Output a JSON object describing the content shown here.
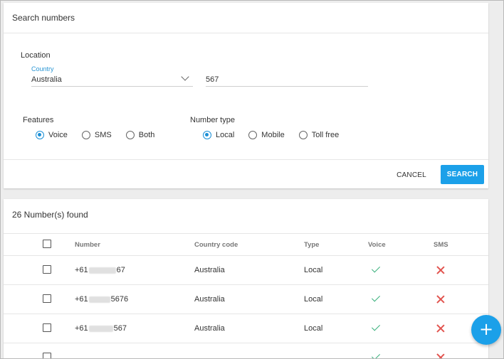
{
  "panel": {
    "title": "Search numbers",
    "location_label": "Location",
    "country": {
      "label": "Country",
      "value": "Australia"
    },
    "contains_value": "567",
    "features": {
      "label": "Features",
      "options": [
        {
          "label": "Voice",
          "checked": true
        },
        {
          "label": "SMS",
          "checked": false
        },
        {
          "label": "Both",
          "checked": false
        }
      ]
    },
    "number_type": {
      "label": "Number type",
      "options": [
        {
          "label": "Local",
          "checked": true
        },
        {
          "label": "Mobile",
          "checked": false
        },
        {
          "label": "Toll free",
          "checked": false
        }
      ]
    },
    "cancel_label": "CANCEL",
    "search_label": "SEARCH"
  },
  "results": {
    "title": "26 Number(s) found",
    "columns": {
      "number": "Number",
      "country_code": "Country code",
      "type": "Type",
      "voice": "Voice",
      "sms": "SMS"
    },
    "rows": [
      {
        "number_prefix": "+61",
        "number_suffix": "67",
        "country": "Australia",
        "type": "Local",
        "voice": "check-icon",
        "sms": "cross-icon"
      },
      {
        "number_prefix": "+61",
        "number_suffix": "5676",
        "country": "Australia",
        "type": "Local",
        "voice": "check-icon",
        "sms": "cross-icon"
      },
      {
        "number_prefix": "+61",
        "number_suffix": "567",
        "country": "Australia",
        "type": "Local",
        "voice": "check-icon",
        "sms": "cross-icon"
      }
    ]
  },
  "fab": {
    "label": "+"
  },
  "colors": {
    "accent": "#1ba0e9",
    "check": "#39b07c",
    "cross": "#e2544f"
  }
}
